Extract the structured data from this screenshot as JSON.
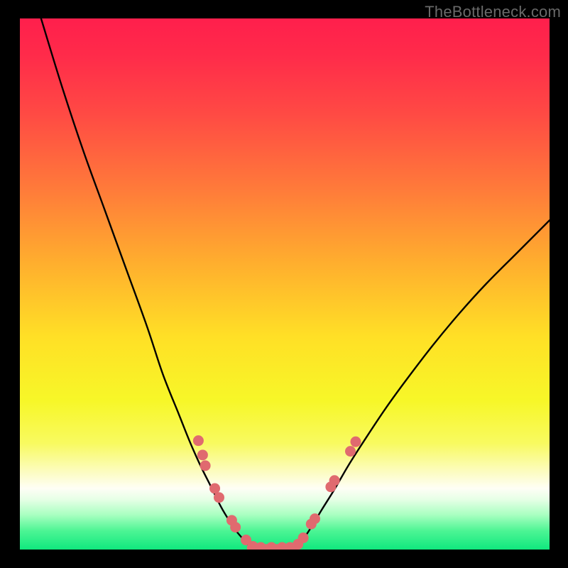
{
  "watermark": "TheBottleneck.com",
  "chart_data": {
    "type": "line",
    "title": "",
    "xlabel": "",
    "ylabel": "",
    "xlim": [
      0,
      100
    ],
    "ylim": [
      0,
      100
    ],
    "grid": false,
    "legend": false,
    "series": [
      {
        "name": "left-curve",
        "x": [
          4,
          8,
          12,
          16,
          20,
          24,
          27,
          30,
          32,
          34,
          36,
          38,
          39.5,
          41,
          42.5,
          43.5
        ],
        "y": [
          100,
          87,
          75,
          64,
          53,
          42,
          33,
          25.5,
          20.5,
          16,
          12,
          8,
          5.5,
          3.3,
          1.6,
          0.5
        ]
      },
      {
        "name": "right-curve",
        "x": [
          52,
          53.5,
          55,
          57,
          59.5,
          62,
          65,
          69,
          73,
          78,
          83,
          88,
          94,
          100
        ],
        "y": [
          0.5,
          2,
          4.2,
          7.5,
          11.5,
          15.8,
          20.5,
          26.5,
          32,
          38.5,
          44.5,
          50,
          56,
          62
        ]
      }
    ],
    "scatter": {
      "name": "data-points",
      "color": "#e06a6f",
      "points": [
        {
          "x": 33.7,
          "y": 20.5
        },
        {
          "x": 34.5,
          "y": 17.8
        },
        {
          "x": 35.0,
          "y": 15.8
        },
        {
          "x": 36.8,
          "y": 11.5
        },
        {
          "x": 37.6,
          "y": 9.8
        },
        {
          "x": 40.0,
          "y": 5.5
        },
        {
          "x": 40.7,
          "y": 4.2
        },
        {
          "x": 42.7,
          "y": 1.8
        },
        {
          "x": 44.0,
          "y": 0.6
        },
        {
          "x": 45.5,
          "y": 0.4
        },
        {
          "x": 47.5,
          "y": 0.4
        },
        {
          "x": 49.5,
          "y": 0.4
        },
        {
          "x": 51.0,
          "y": 0.4
        },
        {
          "x": 52.5,
          "y": 1.0
        },
        {
          "x": 53.5,
          "y": 2.2
        },
        {
          "x": 55.0,
          "y": 4.8
        },
        {
          "x": 55.7,
          "y": 5.8
        },
        {
          "x": 58.7,
          "y": 11.8
        },
        {
          "x": 59.4,
          "y": 13.0
        },
        {
          "x": 62.4,
          "y": 18.5
        },
        {
          "x": 63.4,
          "y": 20.3
        }
      ]
    },
    "flat_segment": {
      "x": [
        43.5,
        52
      ],
      "y": [
        0.35,
        0.35
      ]
    },
    "gradient_stops": [
      {
        "offset": 0.0,
        "color": "#ff1f4c"
      },
      {
        "offset": 0.07,
        "color": "#ff2b4a"
      },
      {
        "offset": 0.18,
        "color": "#ff4a44"
      },
      {
        "offset": 0.32,
        "color": "#ff7a3a"
      },
      {
        "offset": 0.46,
        "color": "#ffae2e"
      },
      {
        "offset": 0.6,
        "color": "#ffe026"
      },
      {
        "offset": 0.72,
        "color": "#f7f728"
      },
      {
        "offset": 0.8,
        "color": "#f8fa60"
      },
      {
        "offset": 0.85,
        "color": "#fcfcba"
      },
      {
        "offset": 0.885,
        "color": "#fefef6"
      },
      {
        "offset": 0.905,
        "color": "#e7ffe7"
      },
      {
        "offset": 0.935,
        "color": "#a8ffc0"
      },
      {
        "offset": 0.965,
        "color": "#4cf594"
      },
      {
        "offset": 1.0,
        "color": "#10e87e"
      }
    ]
  }
}
